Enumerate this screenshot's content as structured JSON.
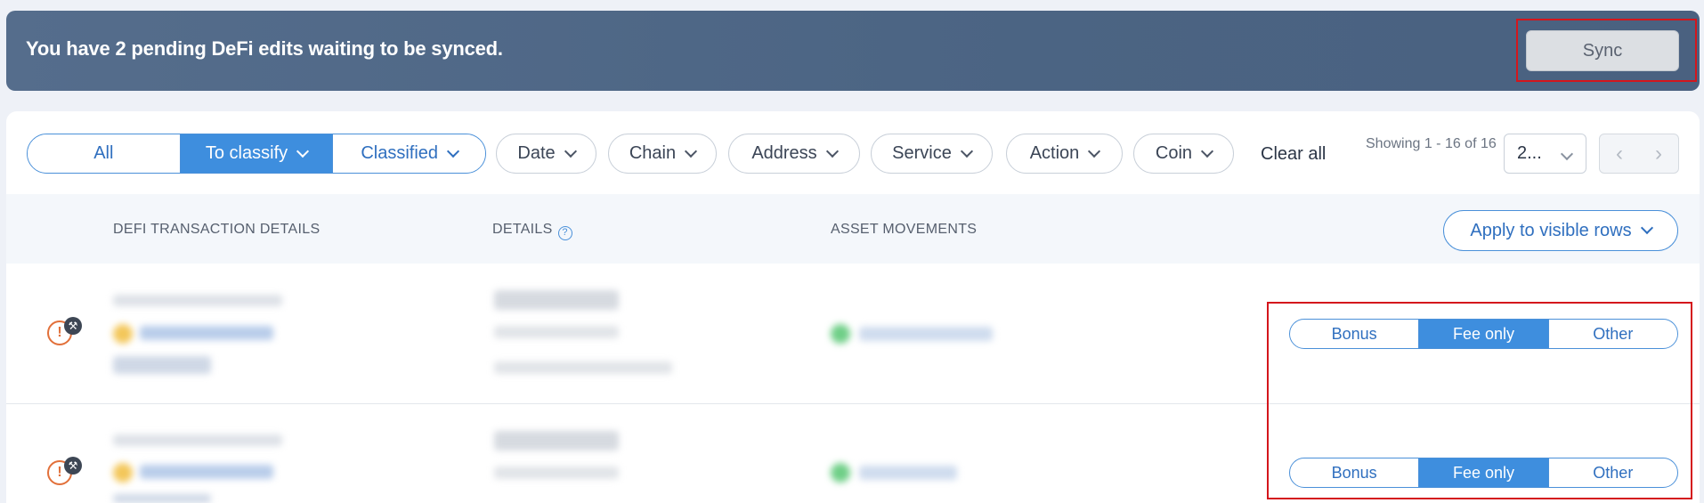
{
  "banner": {
    "message": "You have 2 pending DeFi edits waiting to be synced.",
    "sync_label": "Sync"
  },
  "filters": {
    "segments": [
      {
        "label": "All",
        "active": false,
        "has_dropdown": false
      },
      {
        "label": "To classify",
        "active": true,
        "has_dropdown": true
      },
      {
        "label": "Classified",
        "active": false,
        "has_dropdown": true
      }
    ],
    "dropdowns": [
      "Date",
      "Chain",
      "Address",
      "Service",
      "Action",
      "Coin"
    ],
    "clear_all_label": "Clear all",
    "showing_text": "Showing 1 - 16 of 16",
    "page_size_value": "2...",
    "prev_icon": "chevron-left-icon",
    "next_icon": "chevron-right-icon"
  },
  "table": {
    "headers": {
      "transaction_details": "DEFI TRANSACTION DETAILS",
      "details": "DETAILS",
      "asset_movements": "ASSET MOVEMENTS"
    },
    "apply_label": "Apply to visible rows",
    "rows": [
      {
        "status_icon": "warning-icon",
        "badge_icon": "tools-icon",
        "classification": [
          "Bonus",
          "Fee only",
          "Other"
        ],
        "selected": "Fee only"
      },
      {
        "status_icon": "warning-icon",
        "badge_icon": "tools-icon",
        "classification": [
          "Bonus",
          "Fee only",
          "Other"
        ],
        "selected": "Fee only"
      }
    ]
  },
  "colors": {
    "banner_bg": "#4f6787",
    "accent": "#3e8ede",
    "warning": "#e2703a",
    "highlight_outline": "#d4161c"
  }
}
